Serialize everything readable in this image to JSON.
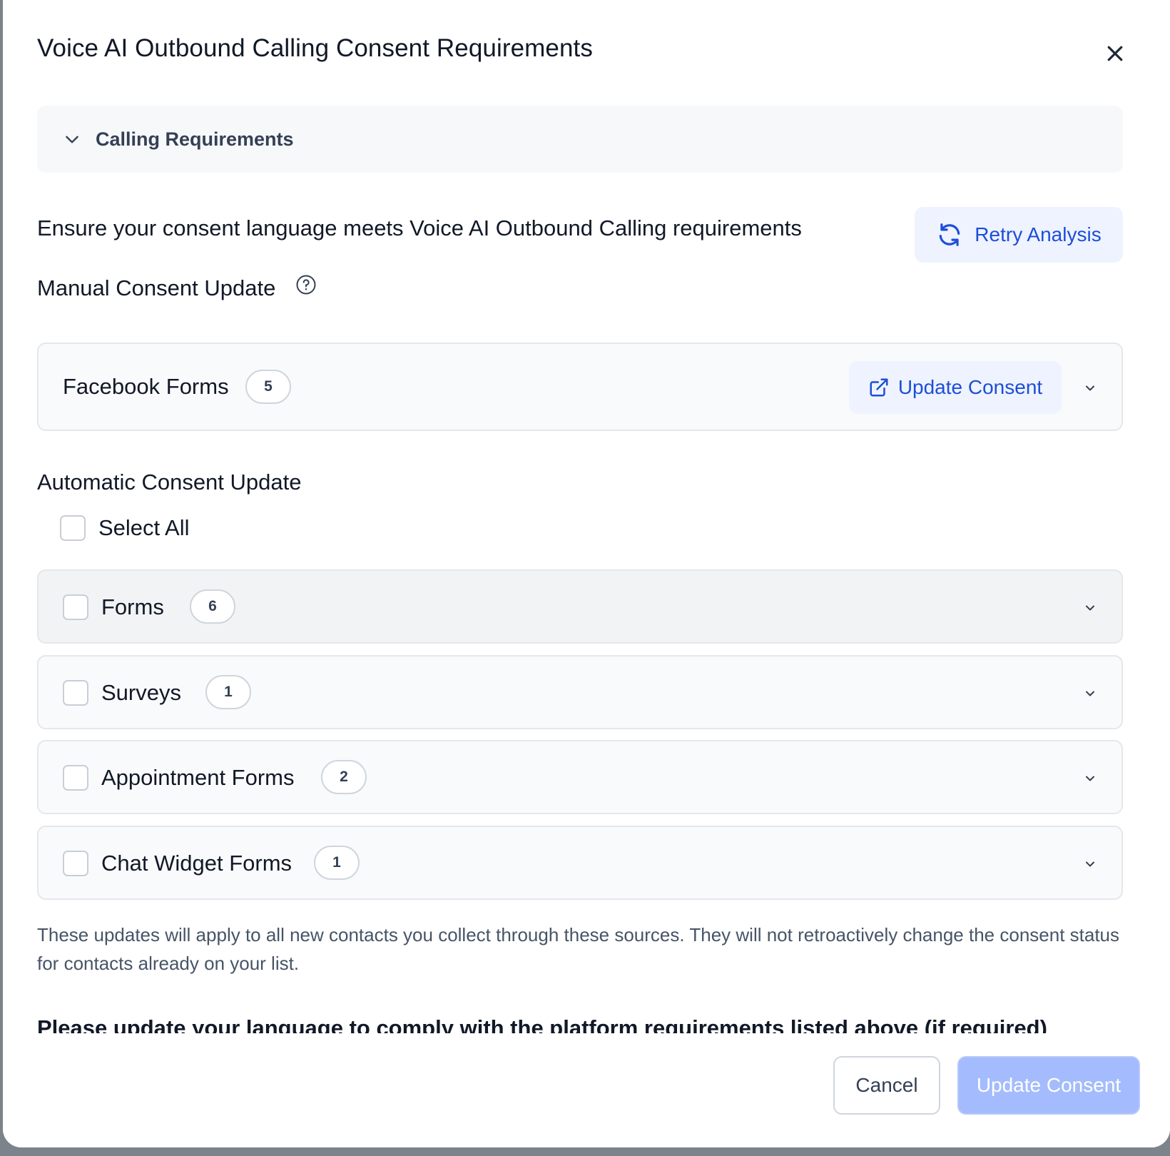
{
  "modal": {
    "title": "Voice AI Outbound Calling Consent Requirements",
    "calling_requirements_label": "Calling Requirements",
    "ensure_text": "Ensure your consent language meets Voice AI Outbound Calling requirements",
    "retry_label": "Retry Analysis"
  },
  "manual": {
    "title": "Manual Consent Update",
    "facebook": {
      "name": "Facebook Forms",
      "count": "5",
      "button_label": "Update Consent"
    }
  },
  "automatic": {
    "title": "Automatic Consent Update",
    "select_all_label": "Select All",
    "sources": [
      {
        "name": "Forms",
        "count": "6"
      },
      {
        "name": "Surveys",
        "count": "1"
      },
      {
        "name": "Appointment Forms",
        "count": "2"
      },
      {
        "name": "Chat Widget Forms",
        "count": "1"
      }
    ]
  },
  "note": "These updates will apply to all new contacts you collect through these sources. They will not retroactively change the consent status for contacts already on your list.",
  "cut_text": "Please update your language to comply with the platform requirements listed above (if required)",
  "footer": {
    "cancel_label": "Cancel",
    "primary_label": "Update Consent"
  },
  "colors": {
    "accent": "#1d4ed8",
    "accent_bg": "#eef3ff",
    "primary_disabled": "#a4bcfd"
  },
  "icons": [
    "close-icon",
    "chevron-down-icon",
    "refresh-icon",
    "help-circle-icon",
    "external-link-icon"
  ]
}
